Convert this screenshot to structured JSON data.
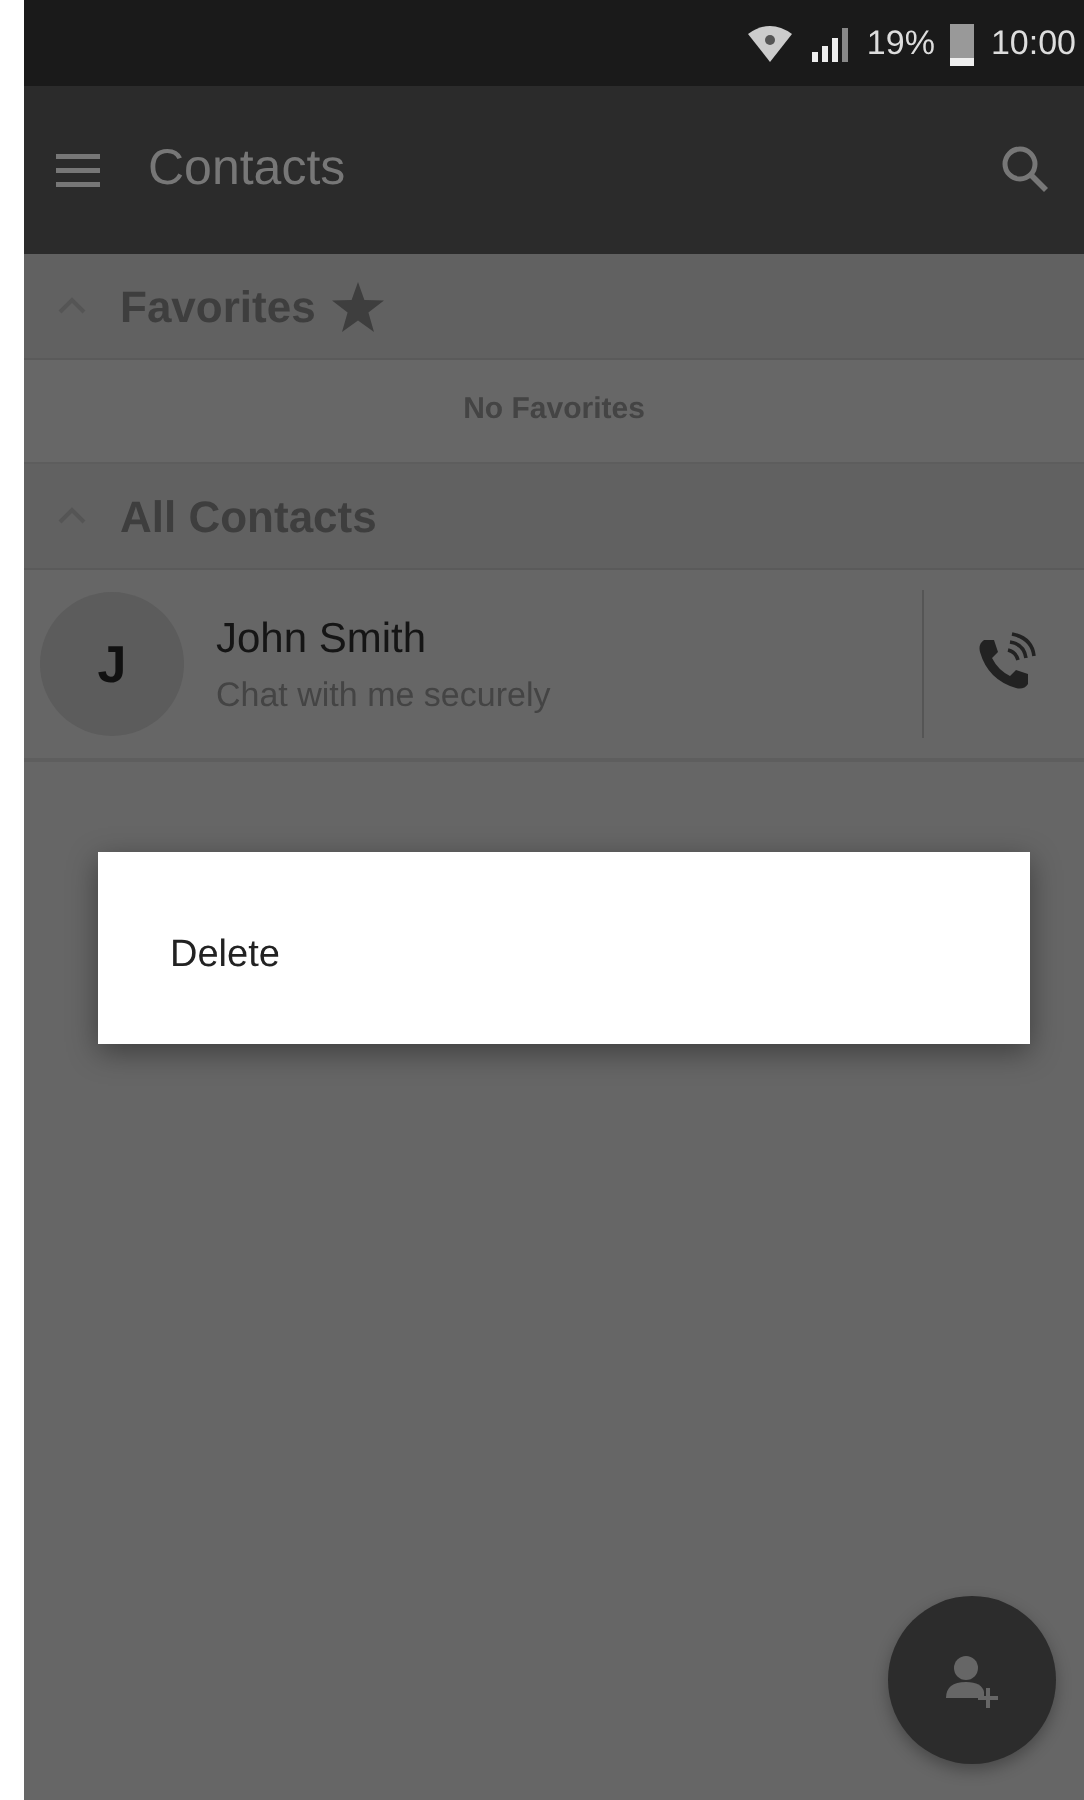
{
  "status_bar": {
    "battery": "19%",
    "time": "10:00"
  },
  "app_bar": {
    "title": "Contacts"
  },
  "sections": [
    {
      "kind": "favorites",
      "title": "Favorites",
      "expanded": true,
      "empty_text": "No Favorites"
    },
    {
      "kind": "all",
      "title": "All Contacts",
      "expanded": true,
      "contacts": [
        {
          "initial": "J",
          "name": "John Smith",
          "status": "Chat with me securely"
        }
      ]
    }
  ],
  "context_menu": {
    "items": [
      "Delete"
    ]
  }
}
